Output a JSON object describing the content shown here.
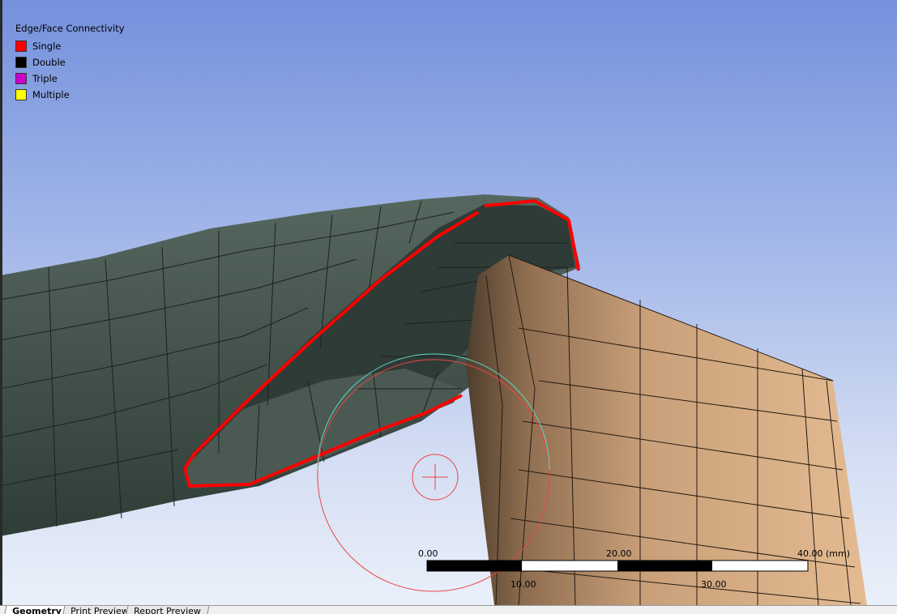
{
  "legend": {
    "title": "Edge/Face Connectivity",
    "items": [
      {
        "label": "Single",
        "color": "#ff0000"
      },
      {
        "label": "Double",
        "color": "#000000"
      },
      {
        "label": "Triple",
        "color": "#cc00cc"
      },
      {
        "label": "Multiple",
        "color": "#ffff00"
      }
    ]
  },
  "scale_bar": {
    "top_labels": [
      "0.00",
      "20.00",
      "40.00 (mm)"
    ],
    "bottom_labels": [
      "10.00",
      "30.00"
    ]
  },
  "tabs": [
    {
      "label": "Geometry",
      "active": true
    },
    {
      "label": "Print Preview",
      "active": false
    },
    {
      "label": "Report Preview",
      "active": false
    }
  ],
  "colors": {
    "green_body": "#3c4c45",
    "tan_body": "#d7aa80",
    "single_edge": "#ff0000"
  }
}
